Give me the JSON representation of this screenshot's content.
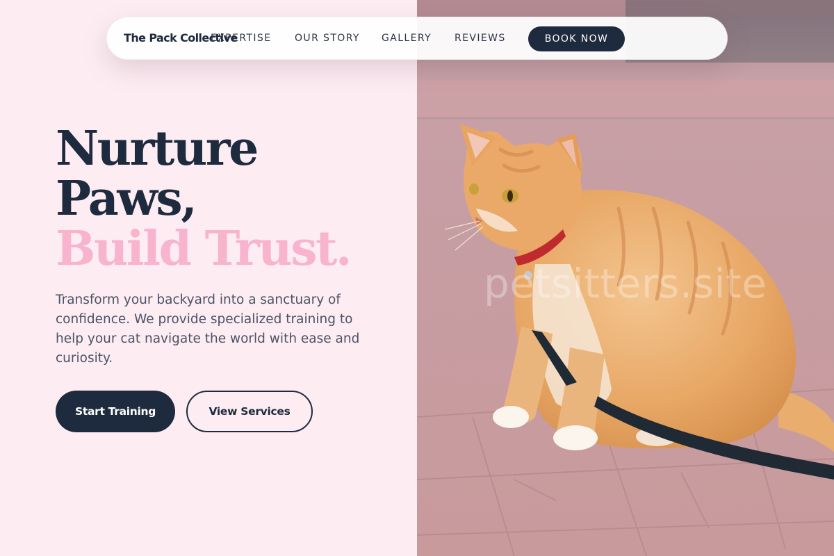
{
  "nav": {
    "brand": "The Pack Collective",
    "links": [
      "EXPERTISE",
      "OUR STORY",
      "GALLERY",
      "REVIEWS"
    ],
    "cta": "BOOK NOW"
  },
  "hero": {
    "title_line1": "Nurture",
    "title_line2": "Paws,",
    "title_line3": "Build Trust.",
    "description": "Transform your backyard into a sanctuary of confidence. We provide specialized training to help your cat navigate the world with ease and curiosity.",
    "primary_button": "Start Training",
    "secondary_button": "View Services"
  },
  "photo": {
    "watermark": "petsitters.site"
  },
  "colors": {
    "navy": "#1e2a3d",
    "pink_accent": "#f7b4cc",
    "background": "#fdedf3"
  }
}
